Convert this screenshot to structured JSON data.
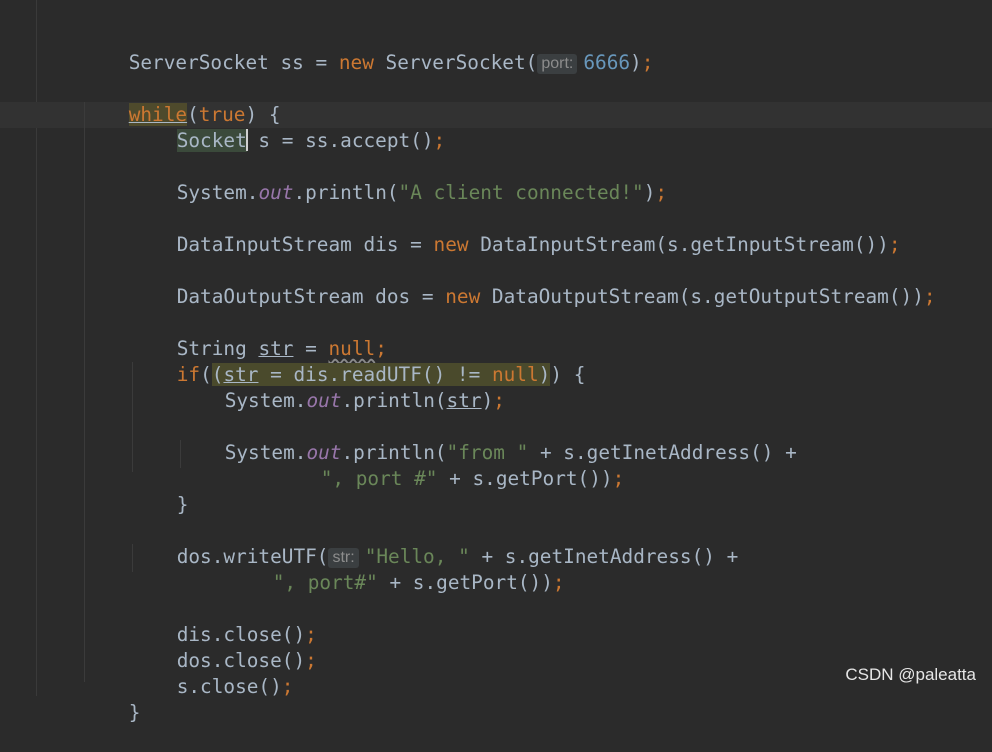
{
  "editor": {
    "hints": {
      "port": "port:",
      "str": "str:"
    },
    "lines": {
      "l1": {
        "a": "ServerSocket ss = ",
        "kw_new": "new",
        "b": " ServerSocket(",
        "num": "6666",
        "c": ")",
        "semi": ";"
      },
      "l2": {
        "kw_while": "while",
        "a": "(",
        "kw_true": "true",
        "b": ") {"
      },
      "l3": {
        "socket": "Socket",
        "a": " s = ss.accept()",
        "semi": ";"
      },
      "l4": {
        "a": "System.",
        "out": "out",
        "b": ".println(",
        "str": "\"A client connected!\"",
        "c": ")",
        "semi": ";"
      },
      "l5": {
        "a": "DataInputStream dis = ",
        "kw_new": "new",
        "b": " DataInputStream(s.getInputStream())",
        "semi": ";"
      },
      "l6": {
        "a": "DataOutputStream dos = ",
        "kw_new": "new",
        "b": " DataOutputStream(s.getOutputStream())",
        "semi": ";"
      },
      "l7": {
        "a": "String ",
        "var": "str",
        "b": " = ",
        "kw_null": "null",
        "semi": ";"
      },
      "l8": {
        "kw_if": "if",
        "a": "(",
        "b": "(",
        "var": "str",
        "c": " = dis.readUTF() != ",
        "kw_null": "null",
        "d": ")",
        "e": ") {"
      },
      "l9": {
        "a": "System.",
        "out": "out",
        "b": ".println(",
        "var": "str",
        "c": ")",
        "semi": ";"
      },
      "l10": {
        "a": "System.",
        "out": "out",
        "b": ".println(",
        "str": "\"from \"",
        "c": " + s.getInetAddress() +"
      },
      "l11": {
        "str": "\", port #\"",
        "a": " + s.getPort())",
        "semi": ";"
      },
      "l12": {
        "a": "}"
      },
      "l13": {
        "a": "dos.writeUTF(",
        "str": "\"Hello, \"",
        "b": " + s.getInetAddress() +"
      },
      "l14": {
        "str": "\", port#\"",
        "a": " + s.getPort())",
        "semi": ";"
      },
      "l15": {
        "a": "dis.close()",
        "semi": ";"
      },
      "l16": {
        "a": "dos.close()",
        "semi": ";"
      },
      "l17": {
        "a": "s.close()",
        "semi": ";"
      },
      "l18": {
        "a": "}"
      }
    }
  },
  "watermark": "CSDN @paleatta",
  "colors": {
    "background": "#2b2b2b",
    "keyword": "#cc7832",
    "number": "#6897bb",
    "string": "#6a8759",
    "field": "#9876aa",
    "text": "#a9b7c6"
  }
}
